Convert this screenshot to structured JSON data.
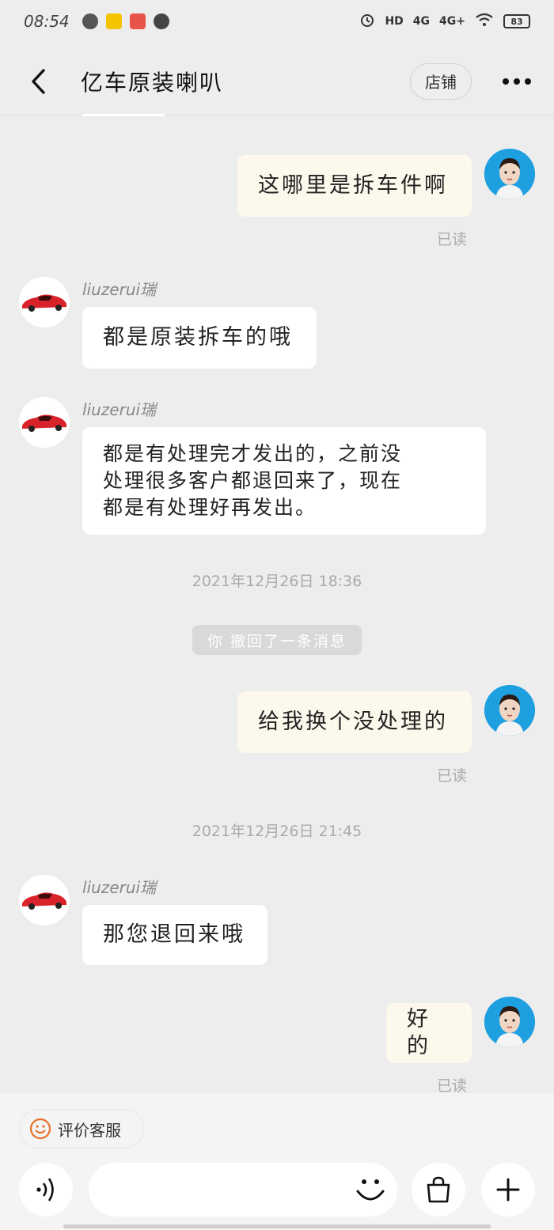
{
  "status_bar": {
    "time": "08:54",
    "signal_1": "HD",
    "signal_2": "4G",
    "signal_3": "4G+",
    "battery": "83"
  },
  "header": {
    "title": "亿车原装喇叭",
    "shop_label": "店铺"
  },
  "messages": [
    {
      "type": "outgoing",
      "text": "这哪里是拆车件啊",
      "read": "已读"
    },
    {
      "type": "incoming",
      "sender": "liuzerui瑞",
      "text": "都是原装拆车的哦"
    },
    {
      "type": "incoming",
      "sender": "liuzerui瑞",
      "lines": [
        "都是有处理完才发出的，之前没",
        "处理很多客户都退回来了，现在",
        "都是有处理好再发出。"
      ]
    },
    {
      "type": "timestamp",
      "text": "2021年12月26日  18:36"
    },
    {
      "type": "notice",
      "text": "你 撤回了一条消息"
    },
    {
      "type": "outgoing",
      "text": "给我换个没处理的",
      "read": "已读"
    },
    {
      "type": "timestamp",
      "text": "2021年12月26日  21:45"
    },
    {
      "type": "incoming",
      "sender": "liuzerui瑞",
      "text": "那您退回来哦"
    },
    {
      "type": "outgoing",
      "text": "好的",
      "read": "已读"
    }
  ],
  "bottom": {
    "rate_label": "评价客服",
    "input_value": ""
  },
  "colors": {
    "background": "#ededed",
    "outgoing_bubble": "#fdf8ec",
    "incoming_bubble": "#ffffff",
    "user_avatar_bg": "#1e9fe0",
    "car_red": "#d8232a"
  }
}
